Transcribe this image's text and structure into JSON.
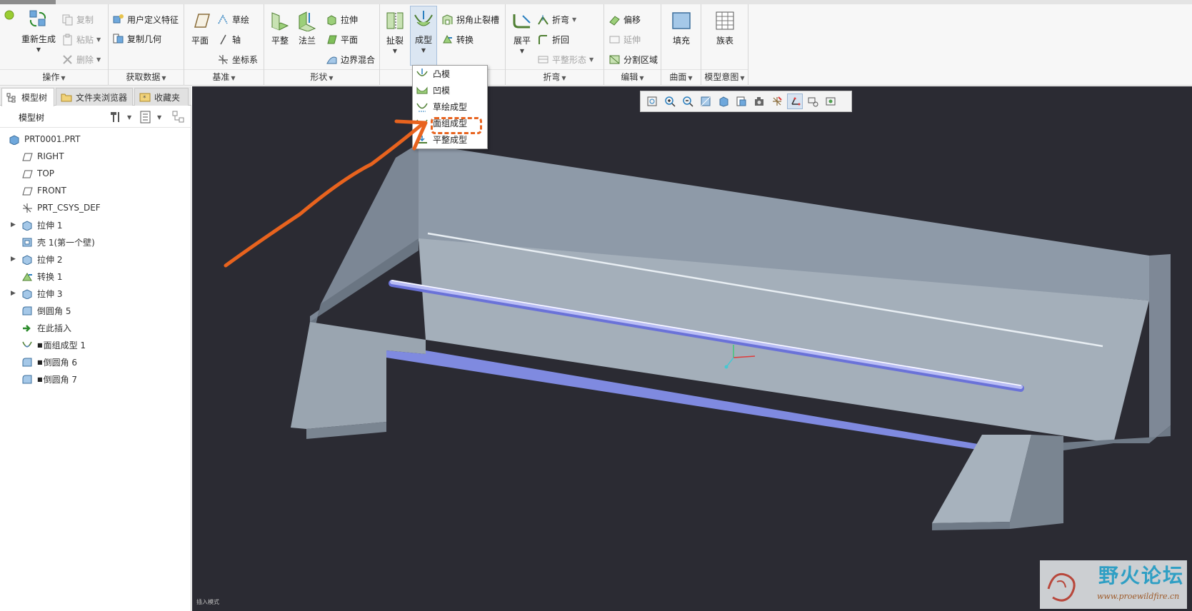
{
  "ribbon": {
    "groups": {
      "operations": {
        "label": "操作",
        "regen": "重新生成",
        "copy": "复制",
        "paste": "粘贴",
        "delete": "删除"
      },
      "get_data": {
        "label": "获取数据",
        "udf": "用户定义特征",
        "copy_geom": "复制几何"
      },
      "datum": {
        "label": "基准",
        "plane": "平面",
        "sketch": "草绘",
        "axis": "轴",
        "csys": "坐标系"
      },
      "shapes": {
        "label": "形状",
        "flat": "平整",
        "flange": "法兰",
        "extrude": "拉伸",
        "planar": "平面",
        "boundary_blend": "边界混合"
      },
      "engineering": {
        "rip": "扯裂",
        "form": "成型",
        "corner_relief": "拐角止裂槽",
        "convert": "转换"
      },
      "bends": {
        "label": "折弯",
        "unbend": "展平",
        "bend": "折弯",
        "bend_back": "折回",
        "flat_state": "平整形态"
      },
      "editing": {
        "label": "编辑",
        "offset": "偏移",
        "extend": "延伸",
        "split_area": "分割区域"
      },
      "surfaces": {
        "label": "曲面",
        "fill": "填充"
      },
      "model_intent": {
        "label": "模型意图",
        "family_table": "族表"
      }
    }
  },
  "form_menu": {
    "items": [
      "凸模",
      "凹模",
      "草绘成型",
      "面组成型",
      "平整成型"
    ]
  },
  "panel_tabs": [
    "模型树",
    "文件夹浏览器",
    "收藏夹"
  ],
  "tree": {
    "title": "模型树",
    "items": [
      {
        "label": "PRT0001.PRT",
        "icon": "part-icon",
        "expandable": false,
        "starred": false
      },
      {
        "label": "RIGHT",
        "icon": "datum-plane-icon",
        "expandable": false,
        "starred": false
      },
      {
        "label": "TOP",
        "icon": "datum-plane-icon",
        "expandable": false,
        "starred": false
      },
      {
        "label": "FRONT",
        "icon": "datum-plane-icon",
        "expandable": false,
        "starred": false
      },
      {
        "label": "PRT_CSYS_DEF",
        "icon": "csys-icon",
        "expandable": false,
        "starred": false
      },
      {
        "label": "拉伸 1",
        "icon": "extrude-icon",
        "expandable": true,
        "starred": false
      },
      {
        "label": "壳 1(第一个壁)",
        "icon": "shell-icon",
        "expandable": false,
        "starred": false
      },
      {
        "label": "拉伸 2",
        "icon": "extrude-icon",
        "expandable": true,
        "starred": false
      },
      {
        "label": "转换 1",
        "icon": "convert-icon",
        "expandable": false,
        "starred": false
      },
      {
        "label": "拉伸 3",
        "icon": "extrude-icon",
        "expandable": true,
        "starred": false
      },
      {
        "label": "倒圆角 5",
        "icon": "round-icon",
        "expandable": false,
        "starred": false
      },
      {
        "label": "在此插入",
        "icon": "insert-here-arrow-icon",
        "expandable": false,
        "starred": false
      },
      {
        "label": "面组成型 1",
        "icon": "quilt-form-icon",
        "expandable": false,
        "starred": true
      },
      {
        "label": "倒圆角 6",
        "icon": "round-icon",
        "expandable": false,
        "starred": true
      },
      {
        "label": "倒圆角 7",
        "icon": "round-icon",
        "expandable": false,
        "starred": true
      }
    ]
  },
  "status": {
    "text": "插入模式"
  },
  "watermark": {
    "title": "野火论坛",
    "url": "www.proewildfire.cn"
  },
  "colors": {
    "accent_orange": "#e8631e",
    "viewport_bg": "#2b2b33",
    "part_gray": "#8f9aa6",
    "highlight_blue": "#8a8fe8"
  }
}
